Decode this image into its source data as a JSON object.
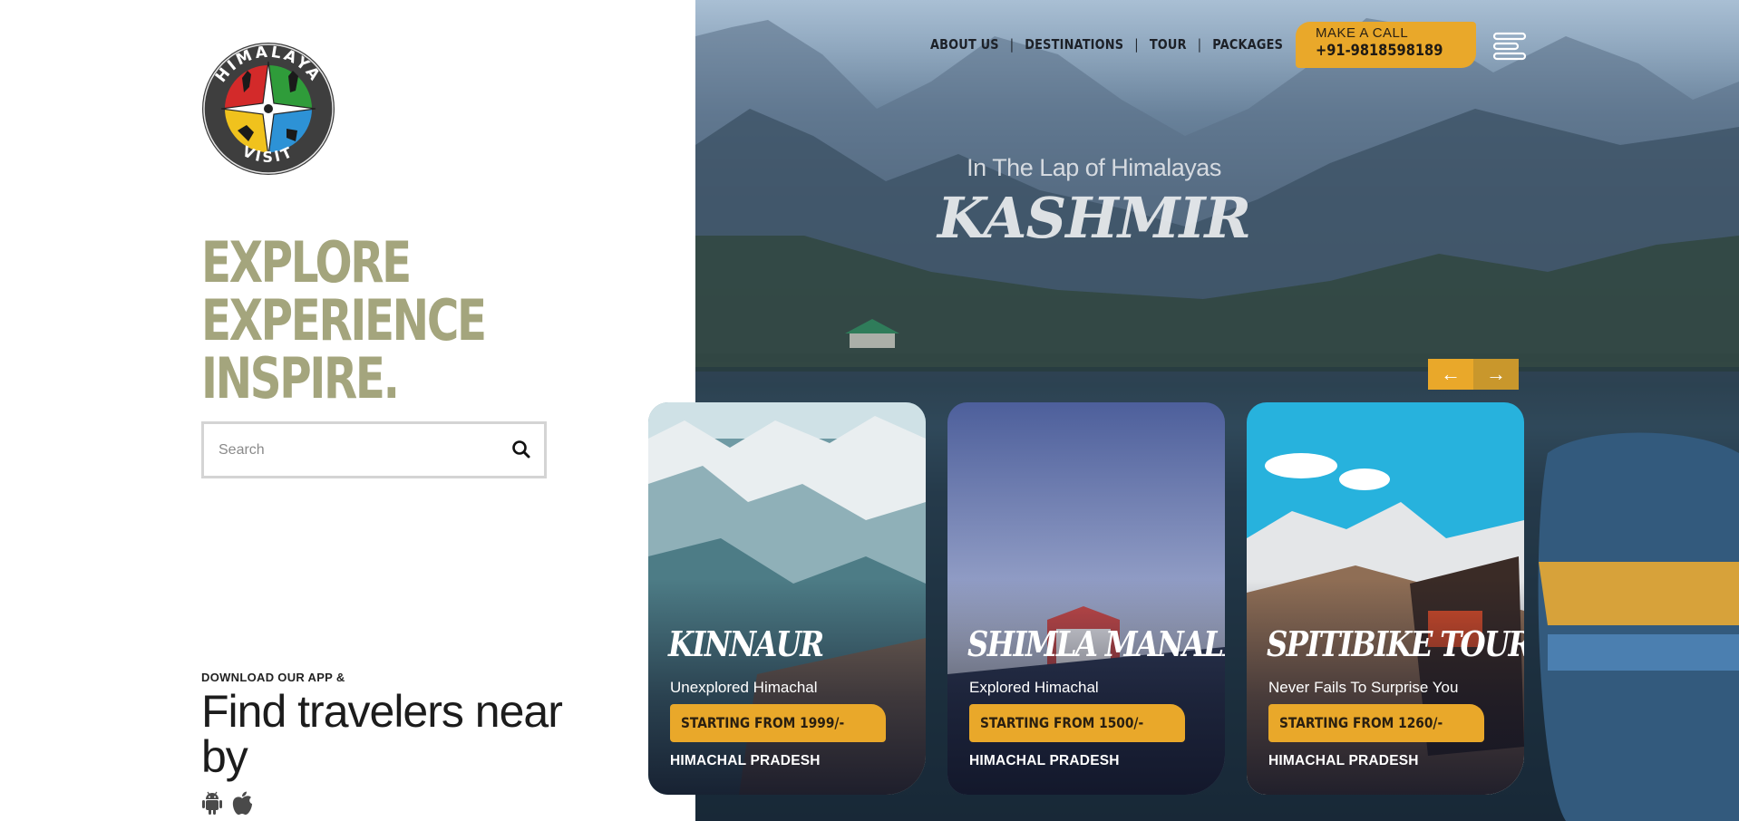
{
  "logo": {
    "alt": "Himalaya Visit",
    "top_text": "HIMALAYA",
    "bottom_text": "VISIT"
  },
  "hero_left": {
    "headline": [
      "EXPLORE",
      "EXPERIENCE",
      "INSPIRE."
    ]
  },
  "search": {
    "placeholder": "Search"
  },
  "app": {
    "caption": "DOWNLOAD OUR APP &",
    "title": "Find travelers near by",
    "icons": [
      "android-icon",
      "apple-icon"
    ]
  },
  "nav": {
    "items": [
      {
        "label": "ABOUT US"
      },
      {
        "label": "DESTINATIONS"
      },
      {
        "label": "TOUR"
      },
      {
        "label": "PACKAGES"
      }
    ],
    "separator": "|"
  },
  "call": {
    "label": "MAKE A CALL",
    "number": "+91-9818598189"
  },
  "hero": {
    "tagline": "In The Lap of Himalayas",
    "title": "KASHMIR",
    "prev_arrow": "←",
    "next_arrow": "→"
  },
  "cards": [
    {
      "name": "KINNAUR",
      "subtitle": "Unexplored Himachal",
      "price": "STARTING FROM 1999/-",
      "region": "HIMACHAL PRADESH"
    },
    {
      "name": "SHIMLA MANALI",
      "subtitle": "Explored Himachal",
      "price": "STARTING FROM 1500/-",
      "region": "HIMACHAL PRADESH"
    },
    {
      "name": "SPITIBIKE TOUR",
      "subtitle": "Never Fails To Surprise You",
      "price": "STARTING FROM 1260/-",
      "region": "HIMACHAL PRADESH"
    }
  ],
  "colors": {
    "accent": "#e9a82a",
    "headline": "#a4a57d",
    "nav_text": "#1d2128"
  }
}
